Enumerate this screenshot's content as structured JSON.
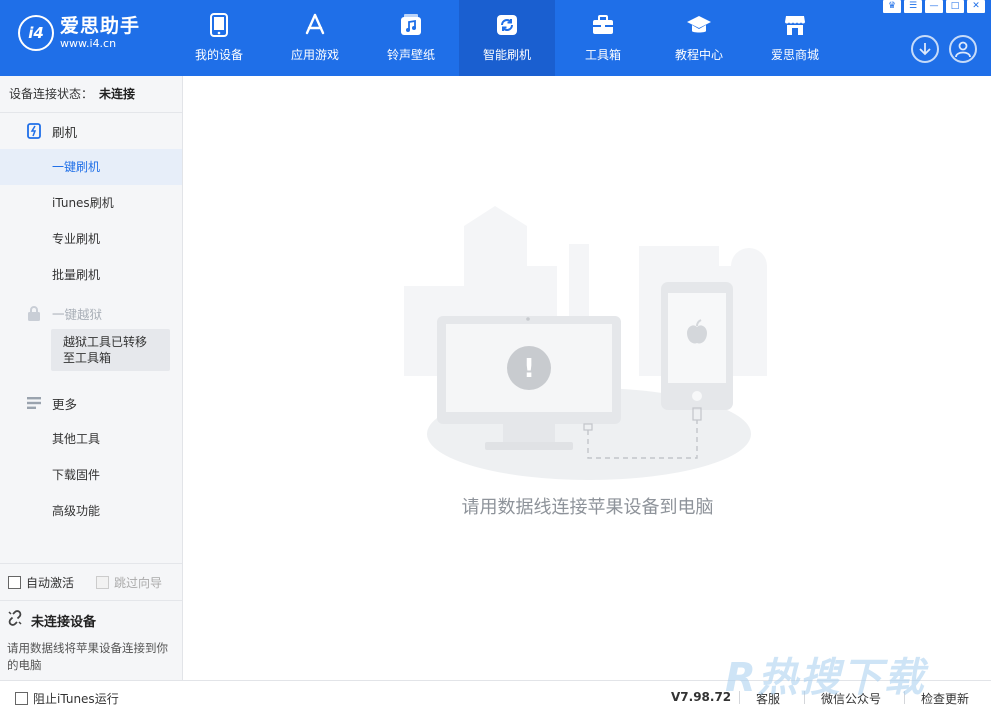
{
  "app": {
    "name": "爱思助手",
    "url": "www.i4.cn",
    "badge": "i4"
  },
  "nav": {
    "items": [
      {
        "label": "我的设备",
        "icon": "phone-icon"
      },
      {
        "label": "应用游戏",
        "icon": "app-store-icon"
      },
      {
        "label": "铃声壁纸",
        "icon": "music-icon"
      },
      {
        "label": "智能刷机",
        "icon": "refresh-icon",
        "active": true
      },
      {
        "label": "工具箱",
        "icon": "toolbox-icon"
      },
      {
        "label": "教程中心",
        "icon": "graduation-cap-icon"
      },
      {
        "label": "爱思商城",
        "icon": "store-icon"
      }
    ]
  },
  "window_controls": [
    "♛",
    "☰",
    "—",
    "□",
    "✕"
  ],
  "sidebar": {
    "status_label": "设备连接状态：",
    "status_value": "未连接",
    "flash_group": "刷机",
    "flash_items": [
      "一键刷机",
      "iTunes刷机",
      "专业刷机",
      "批量刷机"
    ],
    "jailbreak_group": "一键越狱",
    "jailbreak_tooltip": "越狱工具已转移至工具箱",
    "more_group": "更多",
    "more_items": [
      "其他工具",
      "下载固件",
      "高级功能"
    ],
    "auto_activate": "自动激活",
    "skip_guide": "跳过向导",
    "device_title": "未连接设备",
    "device_desc": "请用数据线将苹果设备连接到你的电脑"
  },
  "main": {
    "message": "请用数据线连接苹果设备到电脑"
  },
  "bottom": {
    "block_itunes": "阻止iTunes运行",
    "version": "V7.98.72",
    "links": [
      "客服",
      "微信公众号",
      "检查更新"
    ]
  },
  "watermark": "R热搜下载",
  "colors": {
    "brand_blue": "#1f6fe8",
    "nav_active": "#1a5fd0",
    "sidebar_bg": "#f5f6f8",
    "active_item_bg": "#e7eef9"
  }
}
